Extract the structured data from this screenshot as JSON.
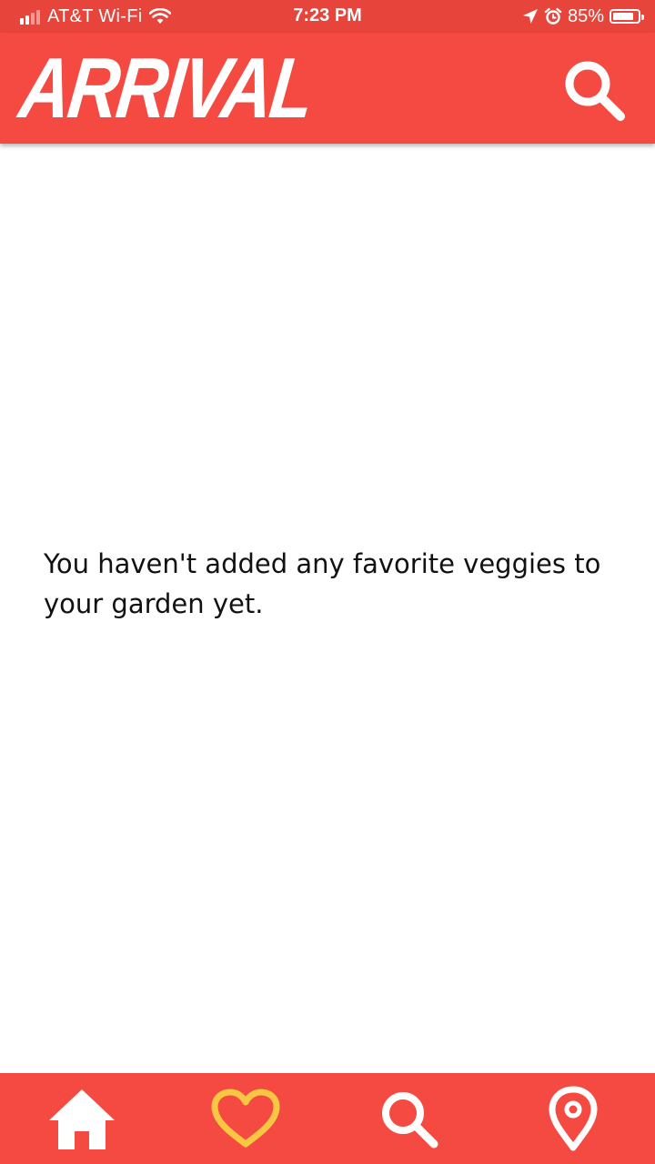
{
  "status_bar": {
    "carrier": "AT&T Wi-Fi",
    "time": "7:23 PM",
    "battery_percent": "85%",
    "battery_level": 0.85,
    "icons": [
      "signal-icon",
      "wifi-icon",
      "location-arrow-icon",
      "alarm-icon",
      "battery-icon"
    ]
  },
  "header": {
    "logo_text": "ARRIVAL",
    "search_icon": "search-icon"
  },
  "main": {
    "empty_message": "You haven't added any favorite veggies to your garden yet."
  },
  "bottom_nav": {
    "items": [
      {
        "icon": "home-icon",
        "active": false
      },
      {
        "icon": "heart-icon",
        "active": true
      },
      {
        "icon": "search-icon",
        "active": false
      },
      {
        "icon": "map-pin-icon",
        "active": false
      }
    ]
  },
  "colors": {
    "primary": "#f44a41",
    "status_bar": "#e7443b",
    "active_icon": "#f7c744",
    "icon": "#ffffff",
    "text": "#111111"
  }
}
